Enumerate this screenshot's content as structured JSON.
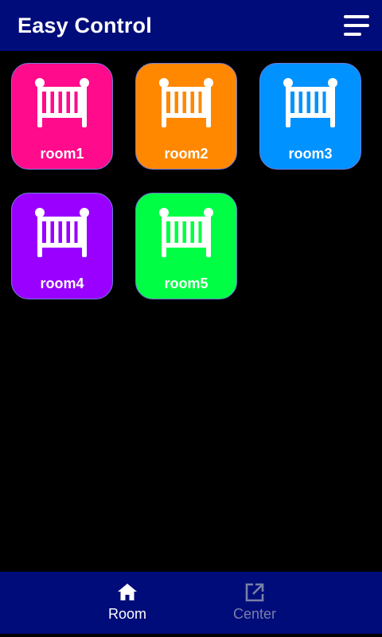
{
  "header": {
    "title": "Easy Control",
    "menu_icon": "menu-icon"
  },
  "rooms": [
    {
      "label": "room1",
      "color": "#ff0b8b",
      "icon": "crib-icon"
    },
    {
      "label": "room2",
      "color": "#ff8800",
      "icon": "crib-icon"
    },
    {
      "label": "room3",
      "color": "#0092ff",
      "icon": "crib-icon"
    },
    {
      "label": "room4",
      "color": "#9900ff",
      "icon": "crib-icon"
    },
    {
      "label": "room5",
      "color": "#00ff44",
      "icon": "crib-icon"
    }
  ],
  "bottom_nav": {
    "items": [
      {
        "label": "Room",
        "icon": "home-icon",
        "active": true
      },
      {
        "label": "Center",
        "icon": "open-external-icon",
        "active": false
      }
    ]
  },
  "colors": {
    "bar_background": "#000c7a",
    "page_background": "#000000",
    "nav_active": "#ffffff",
    "nav_inactive": "#7a7fa8"
  }
}
